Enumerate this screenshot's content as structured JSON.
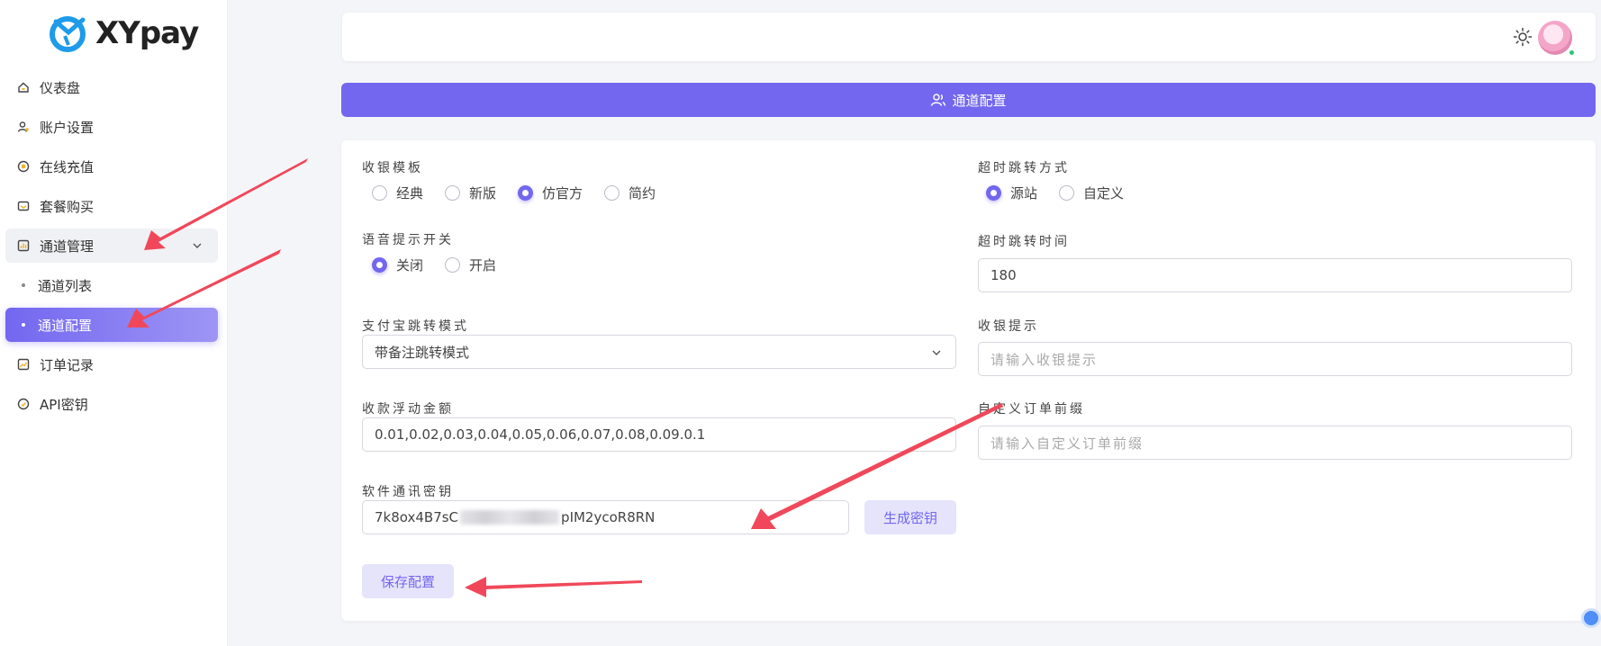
{
  "logo": {
    "text": "XYpay"
  },
  "sidebar": {
    "items": [
      {
        "label": "仪表盘",
        "icon": "home-icon"
      },
      {
        "label": "账户设置",
        "icon": "user-settings-icon"
      },
      {
        "label": "在线充值",
        "icon": "coin-icon"
      },
      {
        "label": "套餐购买",
        "icon": "cart-icon"
      },
      {
        "label": "通道管理",
        "icon": "chart-icon",
        "expanded": true
      },
      {
        "label": "通道列表",
        "sub": true
      },
      {
        "label": "通道配置",
        "sub": true,
        "active": true
      },
      {
        "label": "订单记录",
        "icon": "trend-icon"
      },
      {
        "label": "API密钥",
        "icon": "key-icon"
      }
    ]
  },
  "header": {
    "title": "通道配置",
    "icon": "users-icon"
  },
  "form": {
    "cashier_template": {
      "label": "收银模板",
      "options": [
        "经典",
        "新版",
        "仿官方",
        "简约"
      ],
      "selected": "仿官方"
    },
    "timeout_redirect_mode": {
      "label": "超时跳转方式",
      "options": [
        "源站",
        "自定义"
      ],
      "selected": "源站"
    },
    "voice_switch": {
      "label": "语音提示开关",
      "options": [
        "关闭",
        "开启"
      ],
      "selected": "关闭"
    },
    "timeout_redirect_time": {
      "label": "超时跳转时间",
      "value": "180"
    },
    "alipay_redirect_mode": {
      "label": "支付宝跳转模式",
      "value": "带备注跳转模式"
    },
    "cashier_tip": {
      "label": "收银提示",
      "placeholder": "请输入收银提示"
    },
    "float_amount": {
      "label": "收款浮动金额",
      "value": "0.01,0.02,0.03,0.04,0.05,0.06,0.07,0.08,0.09.0.1"
    },
    "order_prefix": {
      "label": "自定义订单前缀",
      "placeholder": "请输入自定义订单前缀"
    },
    "comm_key": {
      "label": "软件通讯密钥",
      "value_start": "7k8ox4B7sC",
      "value_end": "pIM2ycoR8RN"
    },
    "generate_key_label": "生成密钥",
    "save_label": "保存配置"
  },
  "colors": {
    "primary": "#7367f0",
    "annotation": "#f0485a"
  }
}
